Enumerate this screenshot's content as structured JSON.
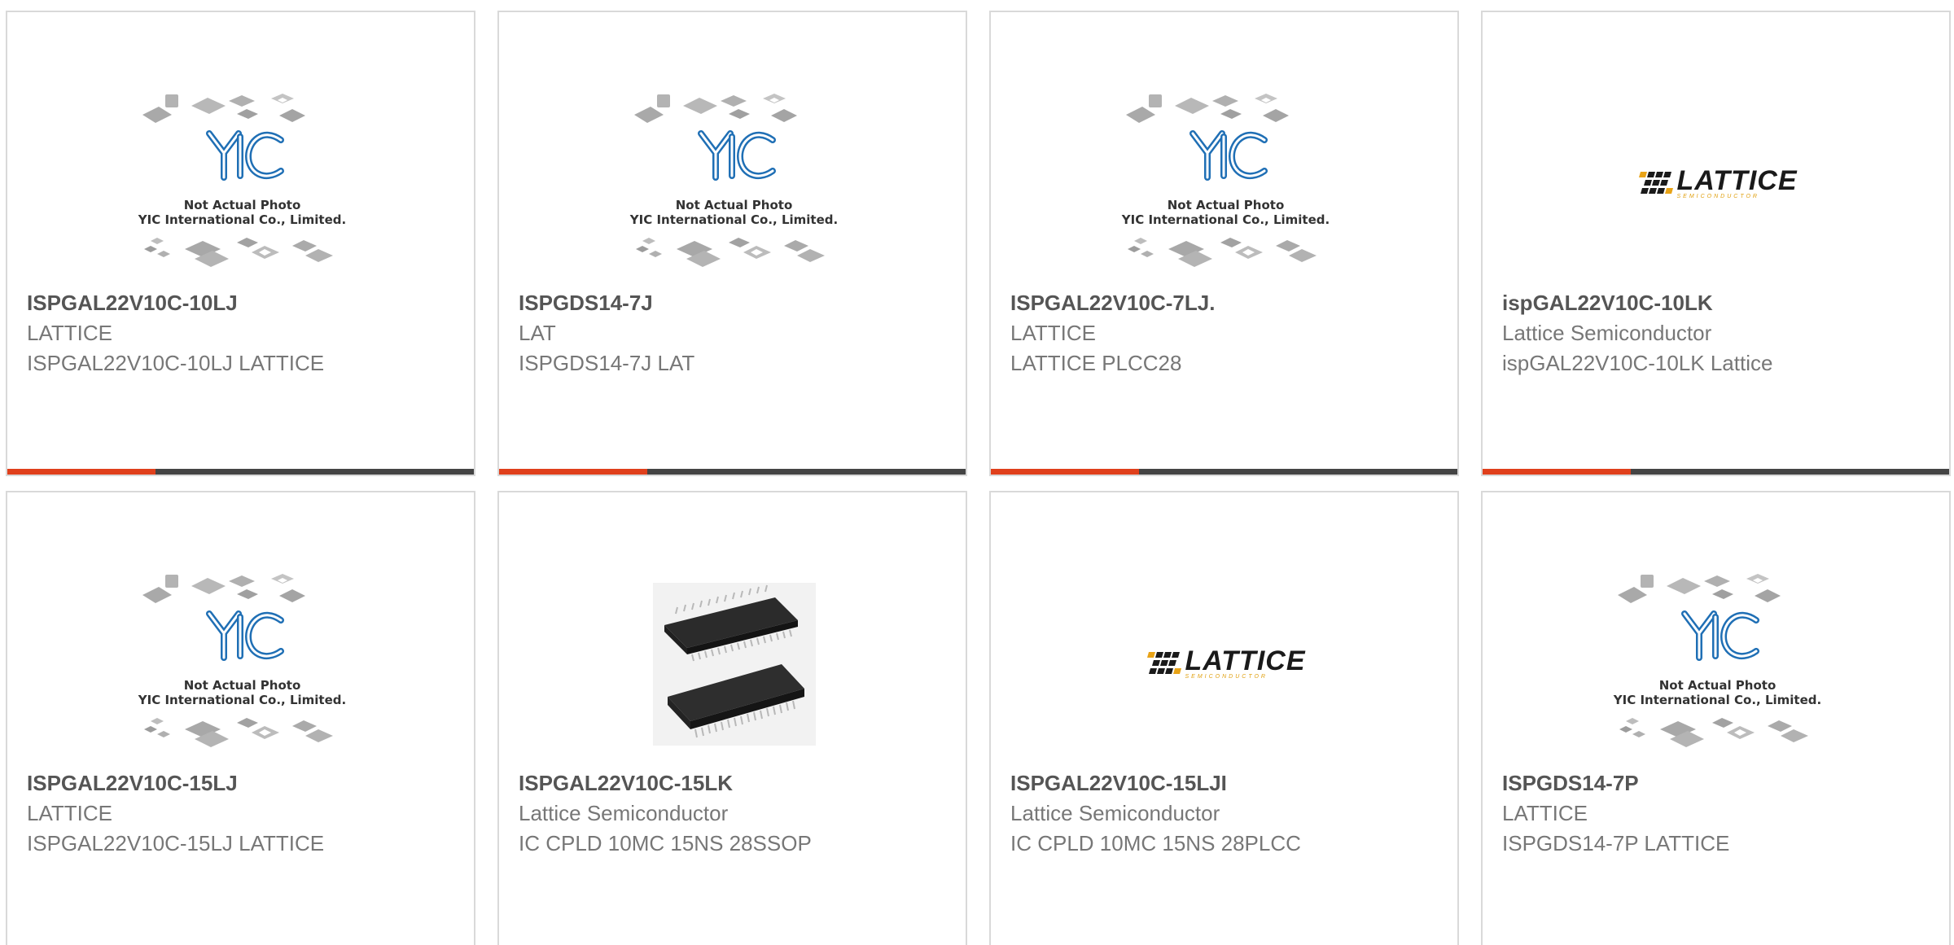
{
  "products": [
    {
      "part": "ISPGAL22V10C-10LJ",
      "manufacturer": "LATTICE",
      "description": "ISPGAL22V10C-10LJ LATTICE",
      "image": "placeholder"
    },
    {
      "part": "ISPGDS14-7J",
      "manufacturer": "LAT",
      "description": "ISPGDS14-7J LAT",
      "image": "placeholder"
    },
    {
      "part": "ISPGAL22V10C-7LJ.",
      "manufacturer": "LATTICE",
      "description": "LATTICE PLCC28",
      "image": "placeholder"
    },
    {
      "part": "ispGAL22V10C-10LK",
      "manufacturer": "Lattice Semiconductor",
      "description": "ispGAL22V10C-10LK Lattice",
      "image": "lattice-logo"
    },
    {
      "part": "ISPGAL22V10C-15LJ",
      "manufacturer": "LATTICE",
      "description": "ISPGAL22V10C-15LJ LATTICE",
      "image": "placeholder"
    },
    {
      "part": "ISPGAL22V10C-15LK",
      "manufacturer": "Lattice Semiconductor",
      "description": "IC CPLD 10MC 15NS 28SSOP",
      "image": "chip-photo"
    },
    {
      "part": "ISPGAL22V10C-15LJI",
      "manufacturer": "Lattice Semiconductor",
      "description": "IC CPLD 10MC 15NS 28PLCC",
      "image": "lattice-logo"
    },
    {
      "part": "ISPGDS14-7P",
      "manufacturer": "LATTICE",
      "description": "ISPGDS14-7P LATTICE",
      "image": "placeholder"
    }
  ],
  "placeholder": {
    "line1": "Not Actual Photo",
    "line2": "YIC International Co., Limited."
  },
  "lattice_logo": {
    "brand": "LATTICE",
    "tagline": "SEMICONDUCTOR"
  },
  "colors": {
    "accent": "#e0401c",
    "bar_dark": "#444444",
    "border": "#d9d9d9",
    "yic_blue": "#1f6fb5"
  }
}
